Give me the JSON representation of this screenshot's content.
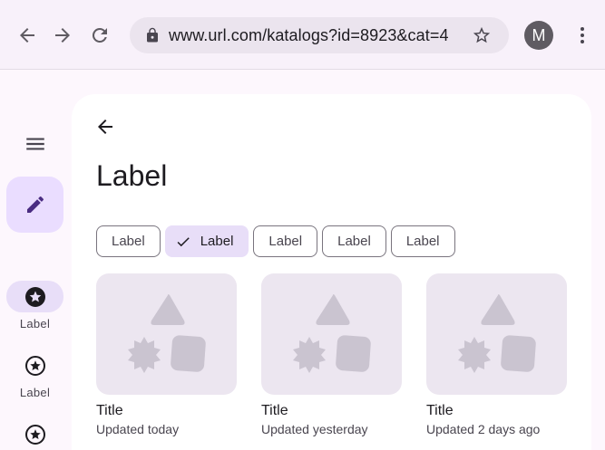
{
  "browser": {
    "url": "www.url.com/katalogs?id=8923&cat=4",
    "avatar_initial": "M"
  },
  "rail": {
    "items": [
      {
        "label": "Label",
        "active": true
      },
      {
        "label": "Label",
        "active": false
      },
      {
        "label": "",
        "active": false
      }
    ]
  },
  "main": {
    "title": "Label",
    "chips": [
      {
        "label": "Label",
        "selected": false
      },
      {
        "label": "Label",
        "selected": true
      },
      {
        "label": "Label",
        "selected": false
      },
      {
        "label": "Label",
        "selected": false
      },
      {
        "label": "Label",
        "selected": false
      }
    ],
    "tiles": [
      {
        "title": "Title",
        "subtitle": "Updated today"
      },
      {
        "title": "Title",
        "subtitle": "Updated yesterday"
      },
      {
        "title": "Title",
        "subtitle": "Updated 2 days ago"
      }
    ]
  },
  "colors": {
    "accent": "#6750a4",
    "selected_container": "#e8def8",
    "fab_container": "#eaddff",
    "placeholder_bg": "#ece6f0",
    "placeholder_shape": "#cac4d0"
  },
  "icons": [
    "back-arrow-icon",
    "forward-arrow-icon",
    "reload-icon",
    "lock-icon",
    "star-outline-icon",
    "more-vert-icon",
    "hamburger-menu-icon",
    "edit-pencil-icon",
    "star-circle-icon",
    "check-icon",
    "image-placeholder-icon"
  ]
}
